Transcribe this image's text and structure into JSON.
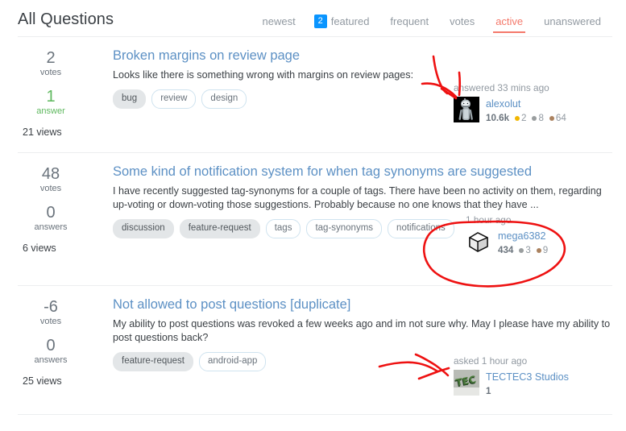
{
  "header": {
    "title": "All Questions",
    "tabs": [
      {
        "label": "newest",
        "badge": null,
        "state": "normal"
      },
      {
        "label": "featured",
        "badge": "2",
        "state": "normal"
      },
      {
        "label": "frequent",
        "badge": null,
        "state": "normal"
      },
      {
        "label": "votes",
        "badge": null,
        "state": "normal"
      },
      {
        "label": "active",
        "badge": null,
        "state": "active"
      },
      {
        "label": "unanswered",
        "badge": null,
        "state": "normal"
      }
    ]
  },
  "colors": {
    "accent_blue": "#0a95ff",
    "active_red": "#f4796b",
    "link_blue": "#5c90c4",
    "answered_green": "#5eb85e",
    "muted_grey": "#9199a1",
    "ink_red": "#ee1111",
    "gold_badge": "#f1b600",
    "silver_badge": "#9a9e9f",
    "bronze_badge": "#ab825f"
  },
  "questions": [
    {
      "votes": "2",
      "votes_label": "votes",
      "answers": "1",
      "answers_label": "answer",
      "answered": true,
      "views": "21 views",
      "title": "Broken margins on review page",
      "excerpt": "Looks like there is something wrong with margins on review pages:",
      "tags": [
        {
          "label": "bug",
          "filled": true
        },
        {
          "label": "review",
          "filled": false
        },
        {
          "label": "design",
          "filled": false
        }
      ],
      "user": {
        "action": "answered 33 mins ago",
        "name": "alexolut",
        "reputation": "10.6k",
        "avatar": "bender-robot-avatar",
        "badges": [
          {
            "type": "gold",
            "count": "2"
          },
          {
            "type": "silver",
            "count": "8"
          },
          {
            "type": "bronze",
            "count": "64"
          }
        ]
      }
    },
    {
      "votes": "48",
      "votes_label": "votes",
      "answers": "0",
      "answers_label": "answers",
      "answered": false,
      "views": "6 views",
      "title": "Some kind of notification system for when tag synonyms are suggested",
      "excerpt": "I have recently suggested tag-synonyms for a couple of tags. There have been no activity on them, regarding up-voting or down-voting those suggestions. Probably because no one knows that they have ...",
      "tags": [
        {
          "label": "discussion",
          "filled": true
        },
        {
          "label": "feature-request",
          "filled": true
        },
        {
          "label": "tags",
          "filled": false
        },
        {
          "label": "tag-synonyms",
          "filled": false
        },
        {
          "label": "notifications",
          "filled": false
        }
      ],
      "user": {
        "action": "1 hour ago",
        "name": "mega6382",
        "reputation": "434",
        "avatar": "white-cube-avatar",
        "badges": [
          {
            "type": "silver",
            "count": "3"
          },
          {
            "type": "bronze",
            "count": "9"
          }
        ]
      }
    },
    {
      "votes": "-6",
      "votes_label": "votes",
      "answers": "0",
      "answers_label": "answers",
      "answered": false,
      "views": "25 views",
      "title": "Not allowed to post questions [duplicate]",
      "excerpt": "My ability to post questions was revoked a few weeks ago and im not sure why. May I please have my ability to post questions back?",
      "tags": [
        {
          "label": "feature-request",
          "filled": true
        },
        {
          "label": "android-app",
          "filled": false
        }
      ],
      "user": {
        "action": "asked 1 hour ago",
        "name": "TECTEC3 Studios",
        "reputation": "1",
        "avatar": "tec-logo-avatar",
        "badges": []
      }
    }
  ],
  "annotations": [
    {
      "kind": "arrow",
      "name": "red-arrow-pointing-to-answered-timestamp"
    },
    {
      "kind": "ellipse",
      "name": "red-circle-around-user-card"
    },
    {
      "kind": "arrow",
      "name": "red-arrow-pointing-to-asked-timestamp"
    }
  ]
}
